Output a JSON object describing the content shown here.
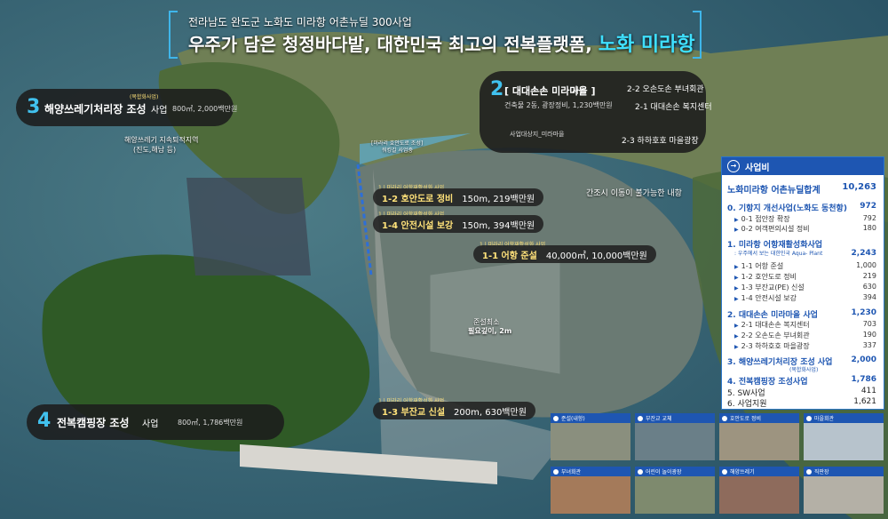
{
  "header": {
    "subtitle": "전라남도 완도군 노화도 미라항 어촌뉴딜 300사업",
    "title_main": "우주가 담은 청정바다밭, 대한민국 최고의 전복플랫폼,",
    "title_highlight": "노화 미라항"
  },
  "callout_2": {
    "number": "2",
    "name": "[ 대대손손 미라마을 ]",
    "type": "사업",
    "detail": "건축물 2동, 광장정비, 1,230백만원",
    "note": "사업대상지_미라마을",
    "items": [
      "2-2 오손도손 부녀회관",
      "2-1 대대손손 복지센터",
      "2-3 하하호호 마을광장"
    ]
  },
  "callout_3": {
    "number": "3",
    "name": "해양쓰레기처리장 조성",
    "type": "사업",
    "tag": "(복합화사업)",
    "detail": "800㎡, 2,000백만원",
    "note1": "해양쓰레기 지속퇴적지역",
    "note2": "(진도,해남 등)"
  },
  "callout_4": {
    "number": "4",
    "name": "전복캠핑장 조성",
    "type": "사업",
    "detail": "800㎡, 1,786백만원"
  },
  "map_labels": {
    "mira_road": "[미라리 호안도로 조성]",
    "mira_road2": "워킹길 사업중",
    "tide_note": "간조시 이동이 불가능한 내항",
    "dredge1": "준설최소",
    "dredge2": "필요깊이, 2m",
    "cap": "1 | 미라리 어항재활성화 사업"
  },
  "tags": [
    {
      "name": "1-2 호안도로 정비",
      "detail": "150m, 219백만원"
    },
    {
      "name": "1-4 안전시설 보강",
      "detail": "150m, 394백만원"
    },
    {
      "name": "1-1 어항 준설",
      "detail": "40,000㎡, 10,000백만원"
    },
    {
      "name": "1-3 부잔교 신설",
      "detail": "200m, 630백만원"
    }
  ],
  "budget": {
    "header": "사업비",
    "total_label": "노화미라항 어촌뉴딜합계",
    "total": "10,263",
    "sections": [
      {
        "title": "0. 기항지 개선사업(노화도 동천항)",
        "value": "972",
        "items": [
          {
            "label": "0-1 접안장 확장",
            "value": "792"
          },
          {
            "label": "0-2 여객편의시설 정비",
            "value": "180"
          }
        ]
      },
      {
        "title": "1. 미라항 어항재활성화사업",
        "sub": ": 우주에서 보는 대한민국 Aqua- Plant",
        "value": "2,243",
        "items": [
          {
            "label": "1-1 어항 준설",
            "value": "1,000"
          },
          {
            "label": "1-2 호안도로 정비",
            "value": "219"
          },
          {
            "label": "1-3 부잔교(PE) 신설",
            "value": "630"
          },
          {
            "label": "1-4 안전시설 보강",
            "value": "394"
          }
        ]
      },
      {
        "title": "2. 대대손손 미라마을 사업",
        "value": "1,230",
        "items": [
          {
            "label": "2-1 대대손손 복지센터",
            "value": "703"
          },
          {
            "label": "2-2 오손도손 부녀회관",
            "value": "190"
          },
          {
            "label": "2-3 하하호호 마을광장",
            "value": "337"
          }
        ]
      },
      {
        "title": "3. 해양쓰레기처리장 조성 사업",
        "sub": "(복합화사업)",
        "value": "2,000"
      },
      {
        "title": "4. 전복캠핑장 조성사업",
        "value": "1,786"
      }
    ],
    "extra": [
      {
        "label": "5. SW사업",
        "value": "411"
      },
      {
        "label": "6. 사업지원",
        "value": "1,621"
      }
    ]
  },
  "gallery": [
    "준설(내항)",
    "부잔교 교체",
    "호안도로 정비",
    "마을회관",
    "부녀회관",
    "어린이 놀이광장",
    "해양쓰레기",
    "직판장"
  ]
}
